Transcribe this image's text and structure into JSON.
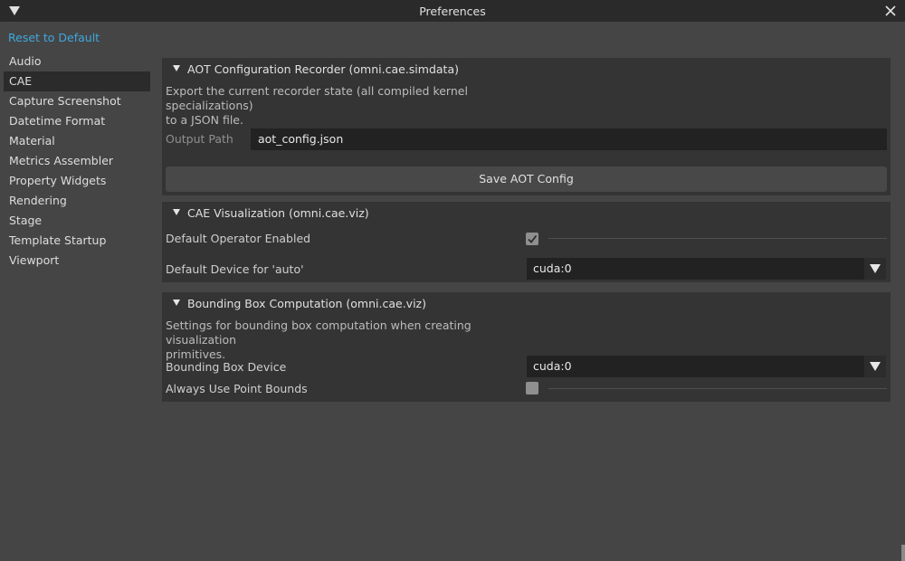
{
  "window": {
    "title": "Preferences",
    "close_icon": "close-icon",
    "menu_icon": "triangle-down-icon"
  },
  "reset_label": "Reset to Default",
  "sidebar": {
    "items": [
      {
        "label": "Audio"
      },
      {
        "label": "CAE",
        "selected": true
      },
      {
        "label": "Capture Screenshot"
      },
      {
        "label": "Datetime Format"
      },
      {
        "label": "Material"
      },
      {
        "label": "Metrics Assembler"
      },
      {
        "label": "Property Widgets"
      },
      {
        "label": "Rendering"
      },
      {
        "label": "Stage"
      },
      {
        "label": "Template Startup"
      },
      {
        "label": "Viewport"
      }
    ]
  },
  "aot": {
    "title": "AOT Configuration Recorder (omni.cae.simdata)",
    "desc_line1": "Export the current recorder state (all compiled kernel specializations)",
    "desc_line2": "to a JSON file.",
    "output_label": "Output Path",
    "output_value": "aot_config.json",
    "save_label": "Save AOT Config"
  },
  "viz": {
    "title": "CAE Visualization (omni.cae.viz)",
    "operator_label": "Default Operator Enabled",
    "operator_checked": true,
    "device_label": "Default Device for 'auto'",
    "device_value": "cuda:0"
  },
  "bbox": {
    "title": "Bounding Box Computation (omni.cae.viz)",
    "desc_line1": "Settings for bounding box computation when creating visualization",
    "desc_line2": "primitives.",
    "device_label": "Bounding Box Device",
    "device_value": "cuda:0",
    "point_bounds_label": "Always Use Point Bounds",
    "point_bounds_checked": false
  },
  "colors": {
    "accent": "#3fa7de",
    "background": "#454545",
    "panel": "#343434",
    "titlebar": "#2a2a2a"
  }
}
